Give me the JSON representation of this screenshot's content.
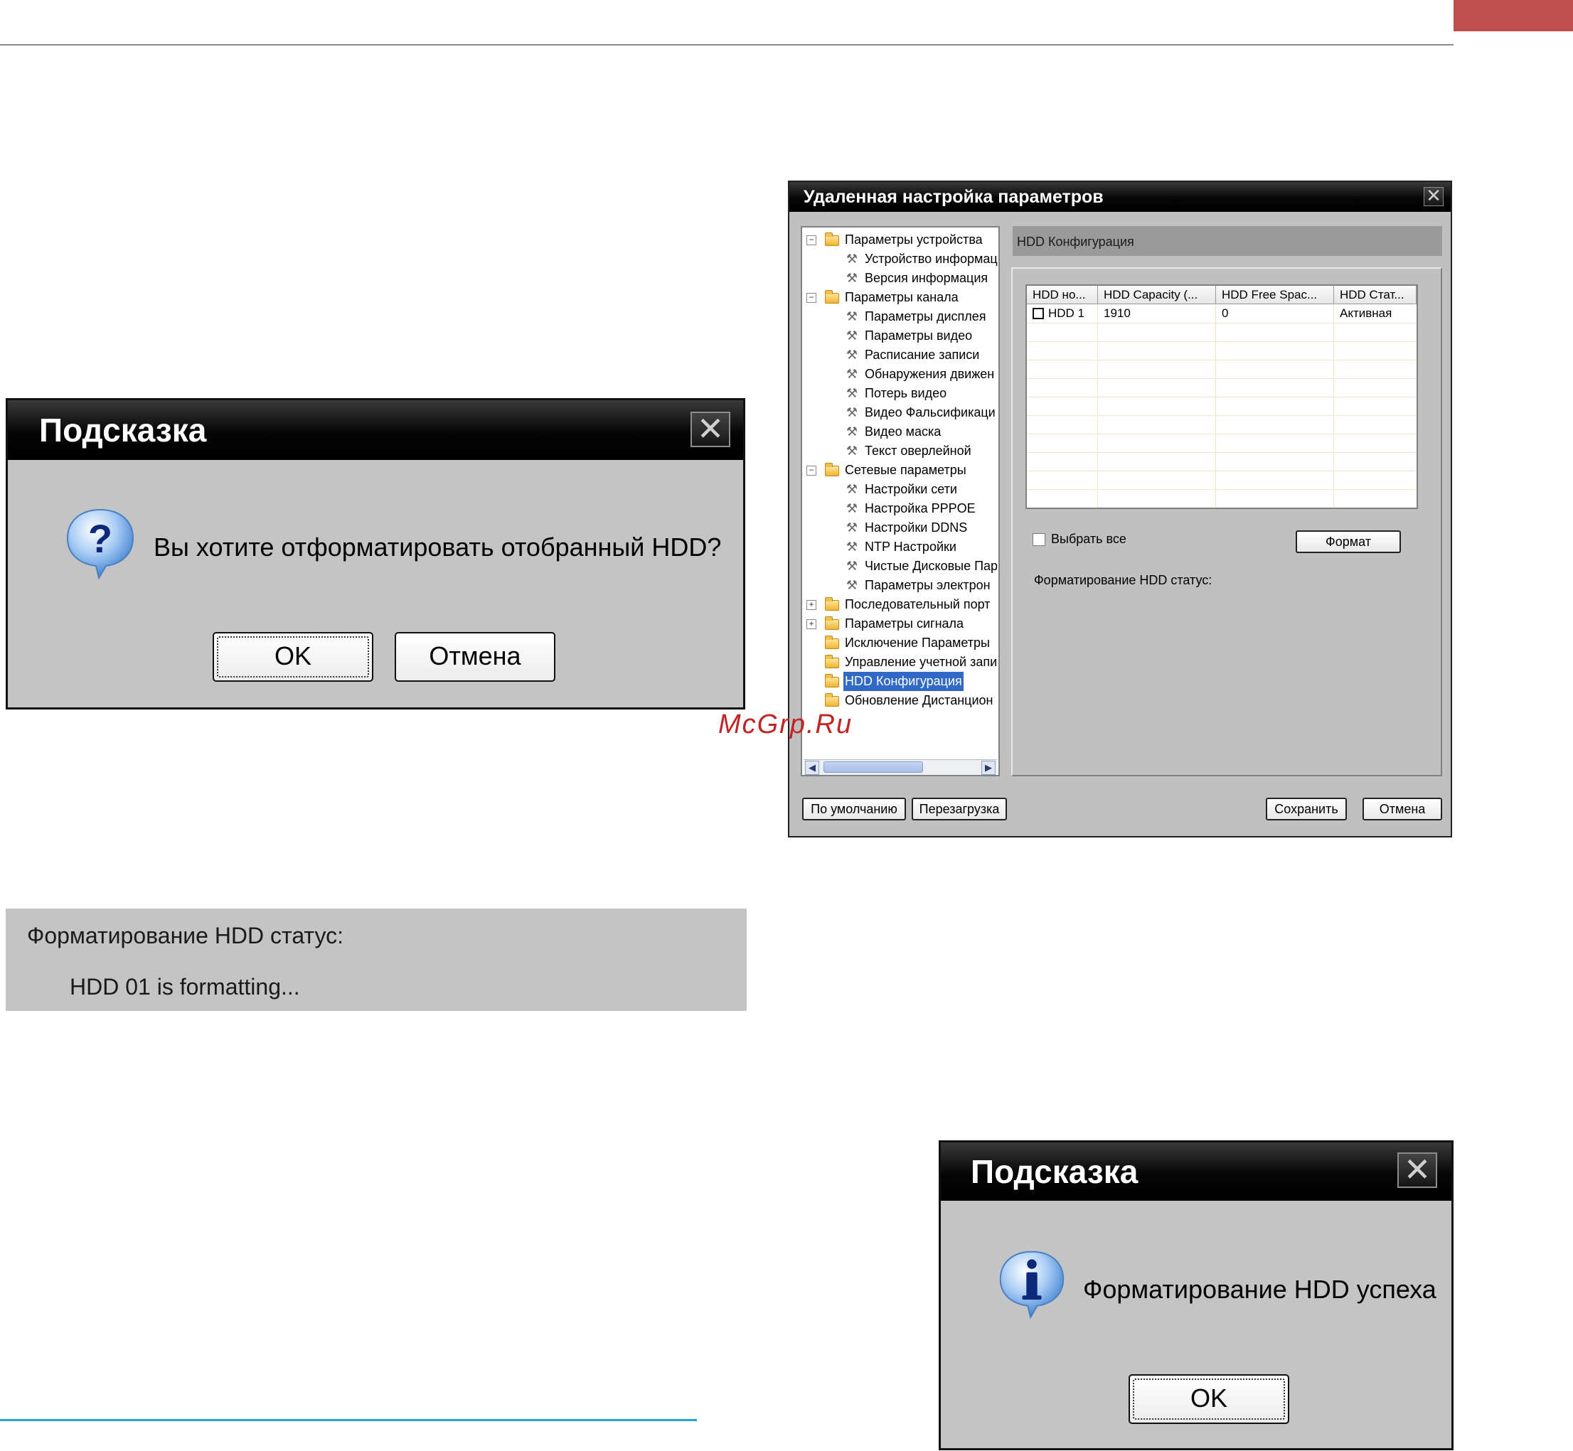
{
  "confirm_dialog": {
    "title": "Подсказка",
    "close_glyph": "✕",
    "icon": "question-icon",
    "message": "Вы хотите отформатировать отобранный HDD?",
    "ok_label": "OK",
    "cancel_label": "Отмена"
  },
  "status_panel": {
    "label": "Форматирование HDD статус:",
    "value": "HDD 01 is formatting..."
  },
  "settings_window": {
    "title": "Удаленная настройка параметров",
    "close_glyph": "✕",
    "tree": [
      {
        "label": "Параметры устройства",
        "type": "folder",
        "expander": "−"
      },
      {
        "label": "Устройство информац",
        "type": "leaf"
      },
      {
        "label": "Версия информация",
        "type": "leaf"
      },
      {
        "label": "Параметры канала",
        "type": "folder",
        "expander": "−"
      },
      {
        "label": "Параметры дисплея",
        "type": "leaf"
      },
      {
        "label": "Параметры видео",
        "type": "leaf"
      },
      {
        "label": "Расписание записи",
        "type": "leaf"
      },
      {
        "label": "Обнаружения движен",
        "type": "leaf"
      },
      {
        "label": "Потерь видео",
        "type": "leaf"
      },
      {
        "label": "Видео Фальсификаци",
        "type": "leaf"
      },
      {
        "label": "Видео маска",
        "type": "leaf"
      },
      {
        "label": "Текст оверлейной",
        "type": "leaf"
      },
      {
        "label": "Сетевые параметры",
        "type": "folder",
        "expander": "−"
      },
      {
        "label": "Настройки сети",
        "type": "leaf"
      },
      {
        "label": "Настройка PPPOE",
        "type": "leaf"
      },
      {
        "label": "Настройки DDNS",
        "type": "leaf"
      },
      {
        "label": "NTP Настройки",
        "type": "leaf"
      },
      {
        "label": "Чистые Дисковые Пар",
        "type": "leaf"
      },
      {
        "label": "Параметры электрон",
        "type": "leaf"
      },
      {
        "label": "Последовательный порт",
        "type": "folder",
        "expander": "+"
      },
      {
        "label": "Параметры сигнала",
        "type": "folder",
        "expander": "+"
      },
      {
        "label": "Исключение Параметры",
        "type": "folder",
        "expander": ""
      },
      {
        "label": "Управление учетной запи",
        "type": "folder",
        "expander": ""
      },
      {
        "label": "HDD Конфигурация",
        "type": "folder",
        "expander": "",
        "selected": true
      },
      {
        "label": "Обновление Дистанцион",
        "type": "folder",
        "expander": ""
      }
    ],
    "section_title": "HDD Конфигурация",
    "table": {
      "columns": [
        "HDD но...",
        "HDD Capacity (...",
        "HDD Free Spac...",
        "HDD Стат..."
      ],
      "rows": [
        [
          "HDD 1",
          "1910",
          "0",
          "Активная"
        ]
      ]
    },
    "select_all_label": "Выбрать все",
    "format_button": "Формат",
    "format_status_label": "Форматирование HDD статус:",
    "buttons": {
      "defaults": "По умолчанию",
      "reboot": "Перезагрузка",
      "save": "Сохранить",
      "cancel": "Отмена"
    }
  },
  "success_dialog": {
    "title": "Подсказка",
    "close_glyph": "✕",
    "icon": "info-icon",
    "message": "Форматирование HDD успеха",
    "ok_label": "OK"
  },
  "watermark": "McGrp.Ru",
  "colors": {
    "accent_tab": "#c0504d",
    "bottom_rule": "#2aa0d8",
    "watermark": "#c22323",
    "selection": "#316ac5",
    "dialog_bg": "#c4c4c4"
  }
}
